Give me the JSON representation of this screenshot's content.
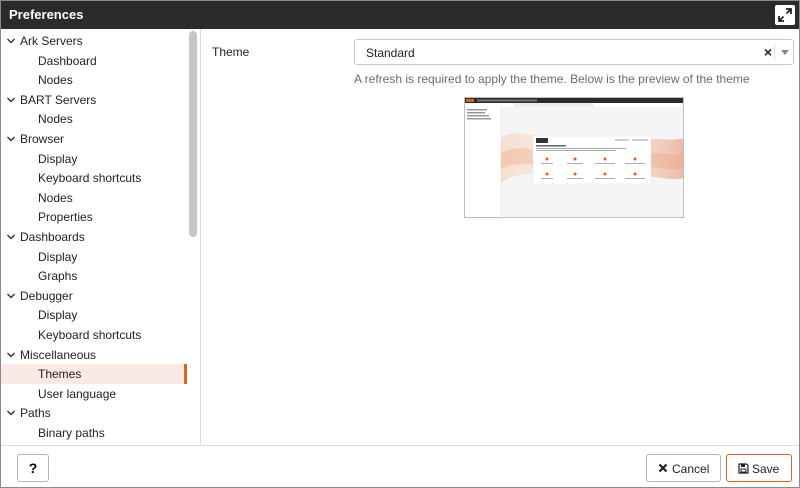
{
  "dialog": {
    "title": "Preferences"
  },
  "sidebar": {
    "items": [
      {
        "label": "Ark Servers",
        "level": "parent"
      },
      {
        "label": "Dashboard",
        "level": "child"
      },
      {
        "label": "Nodes",
        "level": "child"
      },
      {
        "label": "BART Servers",
        "level": "parent"
      },
      {
        "label": "Nodes",
        "level": "child"
      },
      {
        "label": "Browser",
        "level": "parent"
      },
      {
        "label": "Display",
        "level": "child"
      },
      {
        "label": "Keyboard shortcuts",
        "level": "child"
      },
      {
        "label": "Nodes",
        "level": "child"
      },
      {
        "label": "Properties",
        "level": "child"
      },
      {
        "label": "Dashboards",
        "level": "parent"
      },
      {
        "label": "Display",
        "level": "child"
      },
      {
        "label": "Graphs",
        "level": "child"
      },
      {
        "label": "Debugger",
        "level": "parent"
      },
      {
        "label": "Display",
        "level": "child"
      },
      {
        "label": "Keyboard shortcuts",
        "level": "child"
      },
      {
        "label": "Miscellaneous",
        "level": "parent"
      },
      {
        "label": "Themes",
        "level": "child",
        "selected": true
      },
      {
        "label": "User language",
        "level": "child"
      },
      {
        "label": "Paths",
        "level": "parent"
      },
      {
        "label": "Binary paths",
        "level": "child"
      }
    ]
  },
  "content": {
    "theme_label": "Theme",
    "theme_select": {
      "value": "Standard",
      "clear_symbol": "×"
    },
    "hint": "A refresh is required to apply the theme. Below is the preview of the theme",
    "preview_icon": "theme-preview-thumbnail"
  },
  "footer": {
    "help_label": "?",
    "cancel_label": "Cancel",
    "save_label": "Save"
  },
  "colors": {
    "titlebar": "#2b2b2b",
    "accent": "#e0621d",
    "selected_bg": "#fbe9e6",
    "hint_text": "#5f6f7f"
  }
}
